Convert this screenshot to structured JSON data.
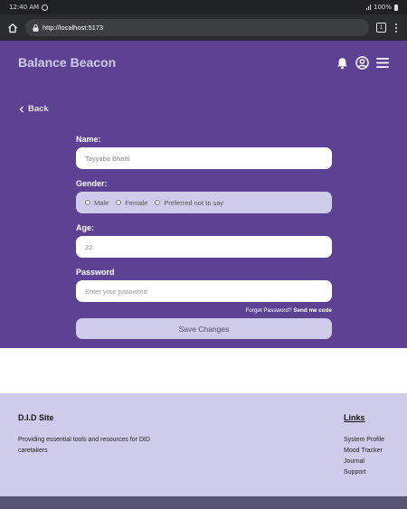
{
  "status_bar": {
    "time": "12:40 AM",
    "battery": "100%"
  },
  "browser": {
    "url": "http://localhost:5173",
    "tab_count": "1"
  },
  "header": {
    "title": "Balance Beacon",
    "icons": [
      "bell-icon",
      "user-circle-icon",
      "menu-icon"
    ]
  },
  "nav": {
    "back_label": "Back"
  },
  "form": {
    "name_label": "Name:",
    "name_value": "Tayyaba Bhatti",
    "gender_label": "Gender:",
    "gender_options": [
      "Male",
      "Female",
      "Preferred not to say"
    ],
    "age_label": "Age:",
    "age_value": "22",
    "password_label": "Password",
    "password_placeholder": "Enter your password",
    "forgot_text": "Forget Password?",
    "send_code_label": "Send me code",
    "save_label": "Save Changes"
  },
  "footer": {
    "site_title": "D.I.D Site",
    "description": "Providing essential tools and resources for DID caretakers",
    "links_title": "Links",
    "links": [
      "System Profile",
      "Mood Tracker",
      "Journal",
      "Support"
    ]
  },
  "colors": {
    "primary": "#5d4293",
    "accent_light": "#cfcbea",
    "bottom_strip": "#575474"
  }
}
